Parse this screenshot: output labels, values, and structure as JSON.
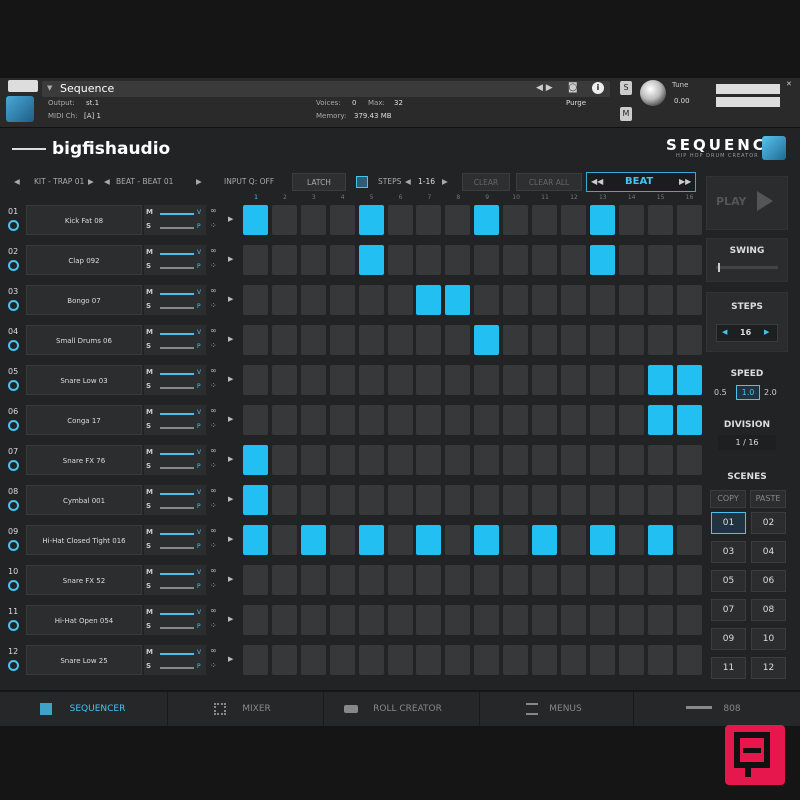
{
  "kontakt": {
    "instrument_name": "Sequence",
    "output_label": "Output:",
    "output_value": "st.1",
    "midi_label": "MIDI Ch:",
    "midi_value": "[A] 1",
    "voices_label": "Voices:",
    "voices_value": "0",
    "max_label": "Max:",
    "max_value": "32",
    "memory_label": "Memory:",
    "memory_value": "379.43 MB",
    "purge_label": "Purge",
    "tune_label": "Tune",
    "tune_value": "0.00",
    "s_label": "S",
    "m_label": "M"
  },
  "brand": {
    "name": "bigfishaudio",
    "product": "SEQUENCE",
    "subtitle": "HIP HOP DRUM CREATOR"
  },
  "topbar": {
    "kit": "KIT - TRAP 01",
    "beat": "BEAT - BEAT 01",
    "input_q": "INPUT Q:  OFF",
    "latch": "LATCH",
    "steps_label": "STEPS",
    "steps_range": "1-16",
    "clear": "CLEAR",
    "clear_all": "CLEAR ALL",
    "beat_mode": "BEAT"
  },
  "step_numbers": [
    "1",
    "2",
    "3",
    "4",
    "5",
    "6",
    "7",
    "8",
    "9",
    "10",
    "11",
    "12",
    "13",
    "14",
    "15",
    "16"
  ],
  "tracks": [
    {
      "num": "01",
      "name": "Kick Fat 08",
      "steps": [
        1,
        0,
        0,
        0,
        1,
        0,
        0,
        0,
        1,
        0,
        0,
        0,
        1,
        0,
        0,
        0
      ]
    },
    {
      "num": "02",
      "name": "Clap 092",
      "steps": [
        0,
        0,
        0,
        0,
        1,
        0,
        0,
        0,
        0,
        0,
        0,
        0,
        1,
        0,
        0,
        0
      ]
    },
    {
      "num": "03",
      "name": "Bongo 07",
      "steps": [
        0,
        0,
        0,
        0,
        0,
        0,
        1,
        1,
        0,
        0,
        0,
        0,
        0,
        0,
        0,
        0
      ]
    },
    {
      "num": "04",
      "name": "Small Drums 06",
      "steps": [
        0,
        0,
        0,
        0,
        0,
        0,
        0,
        0,
        1,
        0,
        0,
        0,
        0,
        0,
        0,
        0
      ]
    },
    {
      "num": "05",
      "name": "Snare Low 03",
      "steps": [
        0,
        0,
        0,
        0,
        0,
        0,
        0,
        0,
        0,
        0,
        0,
        0,
        0,
        0,
        1,
        1
      ]
    },
    {
      "num": "06",
      "name": "Conga 17",
      "steps": [
        0,
        0,
        0,
        0,
        0,
        0,
        0,
        0,
        0,
        0,
        0,
        0,
        0,
        0,
        1,
        1
      ]
    },
    {
      "num": "07",
      "name": "Snare FX 76",
      "steps": [
        1,
        0,
        0,
        0,
        0,
        0,
        0,
        0,
        0,
        0,
        0,
        0,
        0,
        0,
        0,
        0
      ]
    },
    {
      "num": "08",
      "name": "Cymbal 001",
      "steps": [
        1,
        0,
        0,
        0,
        0,
        0,
        0,
        0,
        0,
        0,
        0,
        0,
        0,
        0,
        0,
        0
      ]
    },
    {
      "num": "09",
      "name": "Hi-Hat Closed Tight 016",
      "steps": [
        1,
        0,
        1,
        0,
        1,
        0,
        1,
        0,
        1,
        0,
        1,
        0,
        1,
        0,
        1,
        0
      ]
    },
    {
      "num": "10",
      "name": "Snare FX 52",
      "steps": [
        0,
        0,
        0,
        0,
        0,
        0,
        0,
        0,
        0,
        0,
        0,
        0,
        0,
        0,
        0,
        0
      ]
    },
    {
      "num": "11",
      "name": "Hi-Hat Open 054",
      "steps": [
        0,
        0,
        0,
        0,
        0,
        0,
        0,
        0,
        0,
        0,
        0,
        0,
        0,
        0,
        0,
        0
      ]
    },
    {
      "num": "12",
      "name": "Snare Low 25",
      "steps": [
        0,
        0,
        0,
        0,
        0,
        0,
        0,
        0,
        0,
        0,
        0,
        0,
        0,
        0,
        0,
        0
      ]
    }
  ],
  "track_controls": {
    "m": "M",
    "s": "S",
    "v": "V",
    "p": "P"
  },
  "right_panel": {
    "play": "PLAY",
    "swing": "SWING",
    "steps_label": "STEPS",
    "steps_value": "16",
    "speed_label": "SPEED",
    "speed_options": [
      "0.5",
      "1.0",
      "2.0"
    ],
    "speed_selected": "1.0",
    "division_label": "DIVISION",
    "division_value": "1 / 16",
    "scenes_label": "SCENES",
    "copy": "COPY",
    "paste": "PASTE",
    "scenes": [
      "01",
      "02",
      "03",
      "04",
      "05",
      "06",
      "07",
      "08",
      "09",
      "10",
      "11",
      "12"
    ],
    "scene_selected": "01"
  },
  "tabs": [
    {
      "label": "SEQUENCER",
      "active": true
    },
    {
      "label": "MIXER",
      "active": false
    },
    {
      "label": "ROLL CREATOR",
      "active": false
    },
    {
      "label": "MENUS",
      "active": false
    },
    {
      "label": "808",
      "active": false
    }
  ],
  "colors": {
    "accent": "#22bff2",
    "panel": "#212325",
    "cell_off": "#36383a"
  }
}
